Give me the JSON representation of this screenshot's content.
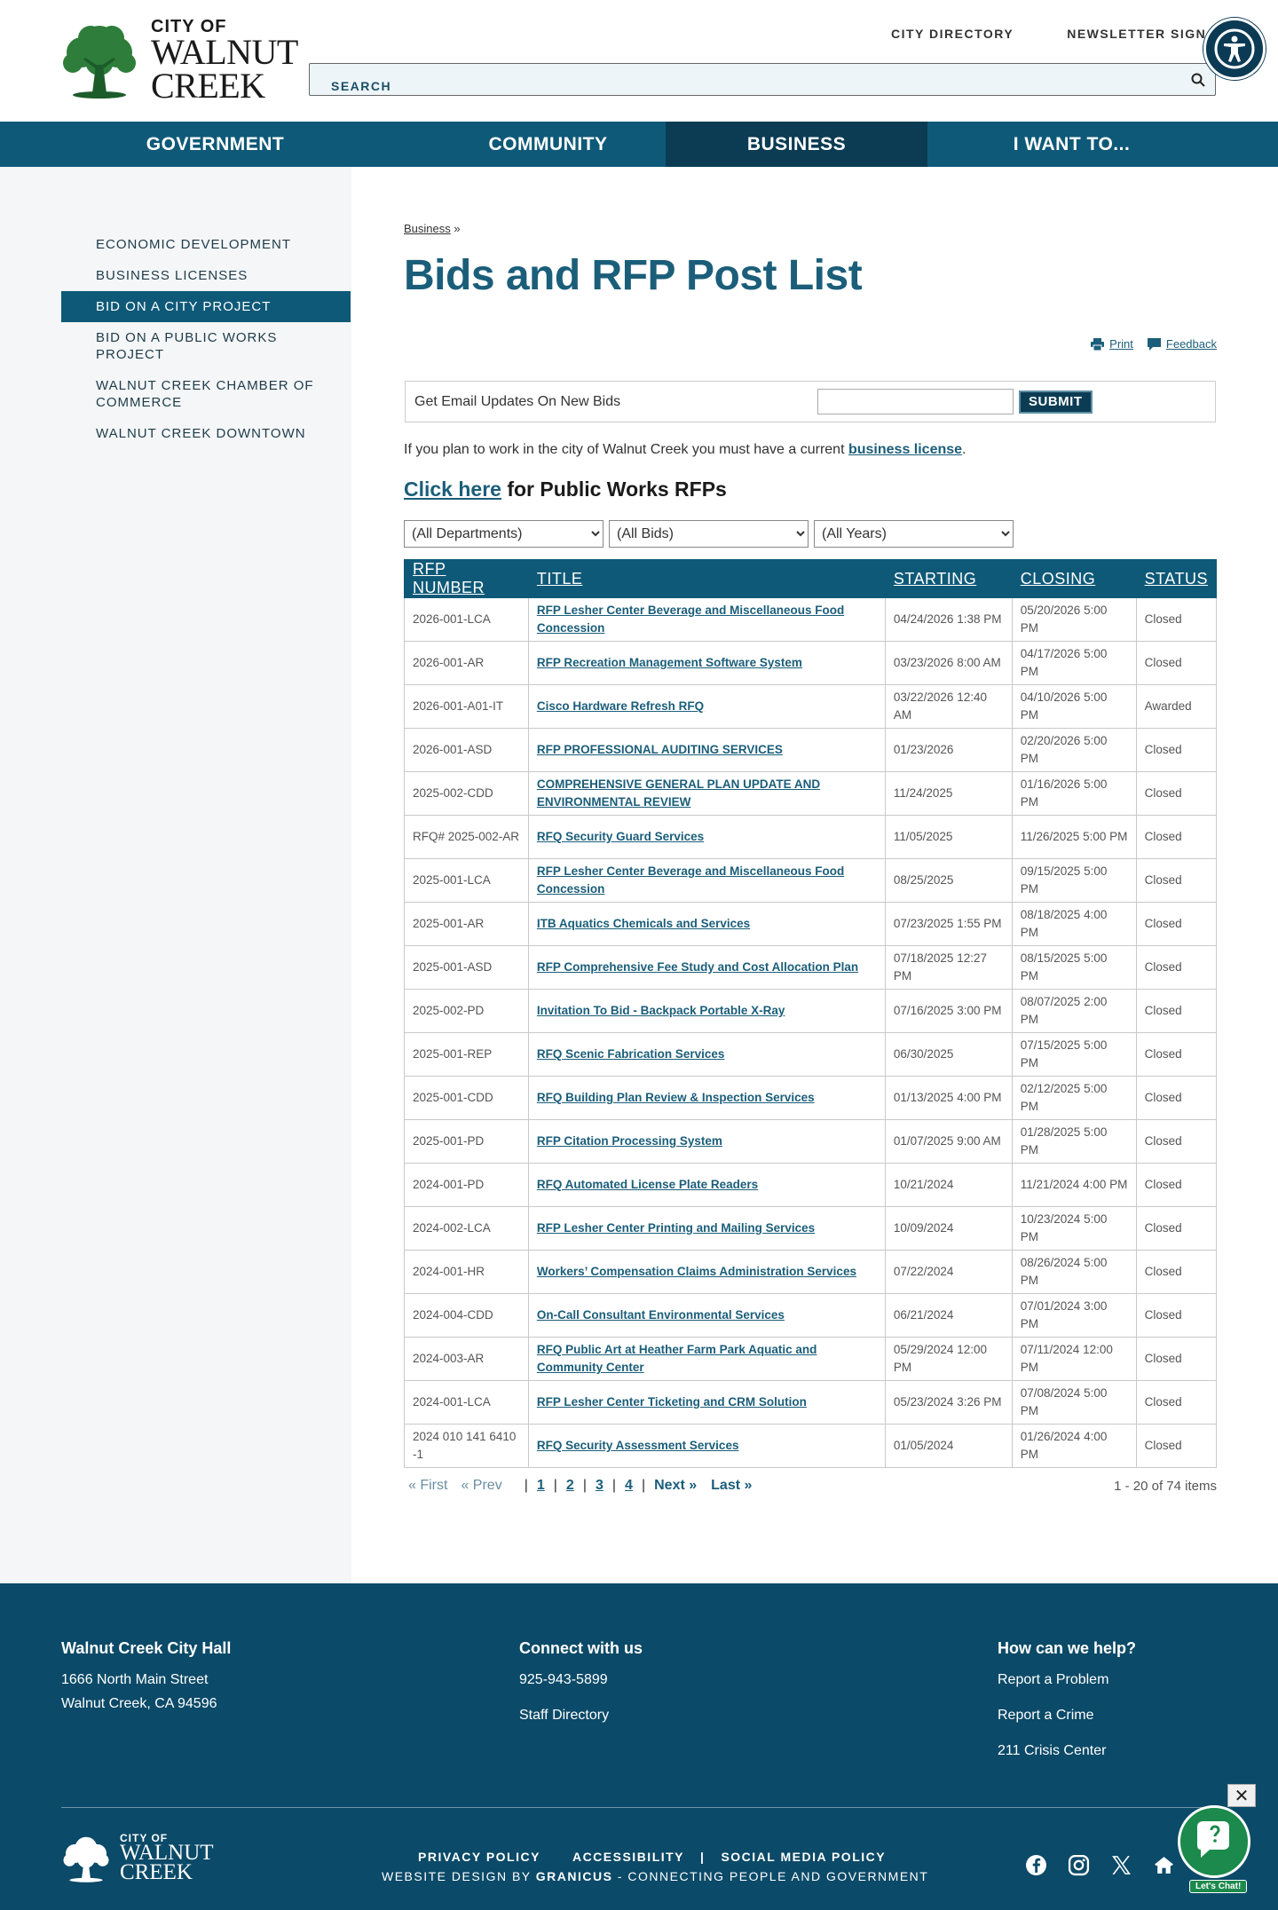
{
  "header": {
    "logo": {
      "line1": "CITY OF",
      "line2": "WALNUT",
      "line3": "CREEK"
    },
    "top_links": [
      "CITY DIRECTORY",
      "NEWSLETTER SIGN UP"
    ],
    "search_placeholder": "SEARCH"
  },
  "nav": {
    "items": [
      "GOVERNMENT",
      "COMMUNITY",
      "BUSINESS",
      "I WANT TO..."
    ],
    "active": "BUSINESS"
  },
  "sidebar": {
    "items": [
      "ECONOMIC DEVELOPMENT",
      "BUSINESS LICENSES",
      "BID ON A CITY PROJECT",
      "BID ON A PUBLIC WORKS PROJECT",
      "WALNUT CREEK CHAMBER OF COMMERCE",
      "WALNUT CREEK DOWNTOWN"
    ],
    "active": "BID ON A CITY PROJECT"
  },
  "main": {
    "breadcrumb": "Business",
    "breadcrumb_sep": "»",
    "title": "Bids and RFP Post List",
    "tools": {
      "print": "Print",
      "feedback": "Feedback"
    },
    "email_label": "Get Email Updates On New Bids",
    "submit_label": "SUBMIT",
    "license_prefix": "If you plan to work in the city of Walnut Creek you must have a current",
    "license_link": "business license",
    "license_suffix": ".",
    "pw_link": "Click here",
    "pw_rest": "for Public Works RFPs",
    "filters": [
      "(All Departments)",
      "(All Bids)",
      "(All Years)"
    ]
  },
  "table": {
    "headers": [
      "RFP NUMBER",
      "TITLE",
      "STARTING",
      "CLOSING",
      "STATUS"
    ],
    "rows": [
      [
        "2026-001-LCA",
        "RFP Lesher Center Beverage and Miscellaneous Food Concession",
        "04/24/2026 1:38 PM",
        "05/20/2026 5:00 PM",
        "Closed"
      ],
      [
        "2026-001-AR",
        "RFP Recreation Management Software System",
        "03/23/2026 8:00 AM",
        "04/17/2026 5:00 PM",
        "Closed"
      ],
      [
        "2026-001-A01-IT",
        "Cisco Hardware Refresh RFQ",
        "03/22/2026 12:40 AM",
        "04/10/2026 5:00 PM",
        "Awarded"
      ],
      [
        "2026-001-ASD",
        "RFP PROFESSIONAL AUDITING SERVICES",
        "01/23/2026",
        "02/20/2026 5:00 PM",
        "Closed"
      ],
      [
        "2025-002-CDD",
        "COMPREHENSIVE GENERAL PLAN UPDATE AND ENVIRONMENTAL REVIEW",
        "11/24/2025",
        "01/16/2026 5:00 PM",
        "Closed"
      ],
      [
        "RFQ# 2025-002-AR",
        "RFQ Security Guard Services",
        "11/05/2025",
        "11/26/2025 5:00 PM",
        "Closed"
      ],
      [
        "2025-001-LCA",
        "RFP Lesher Center Beverage and Miscellaneous Food Concession",
        "08/25/2025",
        "09/15/2025 5:00 PM",
        "Closed"
      ],
      [
        "2025-001-AR",
        "ITB Aquatics Chemicals and Services",
        "07/23/2025 1:55 PM",
        "08/18/2025 4:00 PM",
        "Closed"
      ],
      [
        "2025-001-ASD",
        "RFP Comprehensive Fee Study and Cost Allocation Plan",
        "07/18/2025 12:27 PM",
        "08/15/2025 5:00 PM",
        "Closed"
      ],
      [
        "2025-002-PD",
        "Invitation To Bid - Backpack Portable X-Ray",
        "07/16/2025 3:00 PM",
        "08/07/2025 2:00 PM",
        "Closed"
      ],
      [
        "2025-001-REP",
        "RFQ Scenic Fabrication Services",
        "06/30/2025",
        "07/15/2025 5:00 PM",
        "Closed"
      ],
      [
        "2025-001-CDD",
        "RFQ Building Plan Review & Inspection Services",
        "01/13/2025 4:00 PM",
        "02/12/2025 5:00 PM",
        "Closed"
      ],
      [
        "2025-001-PD",
        "RFP Citation Processing System",
        "01/07/2025 9:00 AM",
        "01/28/2025 5:00 PM",
        "Closed"
      ],
      [
        "2024-001-PD",
        "RFQ Automated License Plate Readers",
        "10/21/2024",
        "11/21/2024 4:00 PM",
        "Closed"
      ],
      [
        "2024-002-LCA",
        "RFP Lesher Center Printing and Mailing Services",
        "10/09/2024",
        "10/23/2024 5:00 PM",
        "Closed"
      ],
      [
        "2024-001-HR",
        "Workers’ Compensation Claims Administration Services",
        "07/22/2024",
        "08/26/2024 5:00 PM",
        "Closed"
      ],
      [
        "2024-004-CDD",
        "On-Call Consultant Environmental Services",
        "06/21/2024",
        "07/01/2024 3:00 PM",
        "Closed"
      ],
      [
        "2024-003-AR",
        "RFQ Public Art at Heather Farm Park Aquatic and Community Center",
        "05/29/2024 12:00 PM",
        "07/11/2024 12:00 PM",
        "Closed"
      ],
      [
        "2024-001-LCA",
        "RFP Lesher Center Ticketing and CRM Solution",
        "05/23/2024 3:26 PM",
        "07/08/2024 5:00 PM",
        "Closed"
      ],
      [
        "2024 010 141 6410 -1",
        "RFQ Security Assessment Services",
        "01/05/2024",
        "01/26/2024 4:00 PM",
        "Closed"
      ]
    ]
  },
  "pager": {
    "first": "« First",
    "prev": "« Prev",
    "pages": [
      "1",
      "2",
      "3",
      "4"
    ],
    "next": "Next »",
    "last": "Last »",
    "count": "1 - 20 of 74 items"
  },
  "footer": {
    "col1": {
      "title": "Walnut Creek City Hall",
      "line1": "1666 North Main Street",
      "line2": "Walnut Creek, CA 94596"
    },
    "col2": {
      "title": "Connect with us",
      "links": [
        "925-943-5899",
        "Staff Directory"
      ]
    },
    "col3": {
      "title": "How can we help?",
      "links": [
        "Report a Problem",
        "Report a Crime",
        "211 Crisis Center"
      ]
    },
    "links": [
      "PRIVACY POLICY",
      "ACCESSIBILITY",
      "SOCIAL MEDIA POLICY"
    ],
    "credit_prefix": "WEBSITE DESIGN BY",
    "credit_brand": "GRANICUS",
    "credit_suffix": "- CONNECTING PEOPLE AND GOVERNMENT",
    "chat_label": "Let's Chat!",
    "close_symbol": "✕"
  },
  "colors": {
    "primary": "#0f5978",
    "dark": "#0b3c54",
    "footer": "#0b4a68",
    "chat": "#1b8a4c"
  }
}
